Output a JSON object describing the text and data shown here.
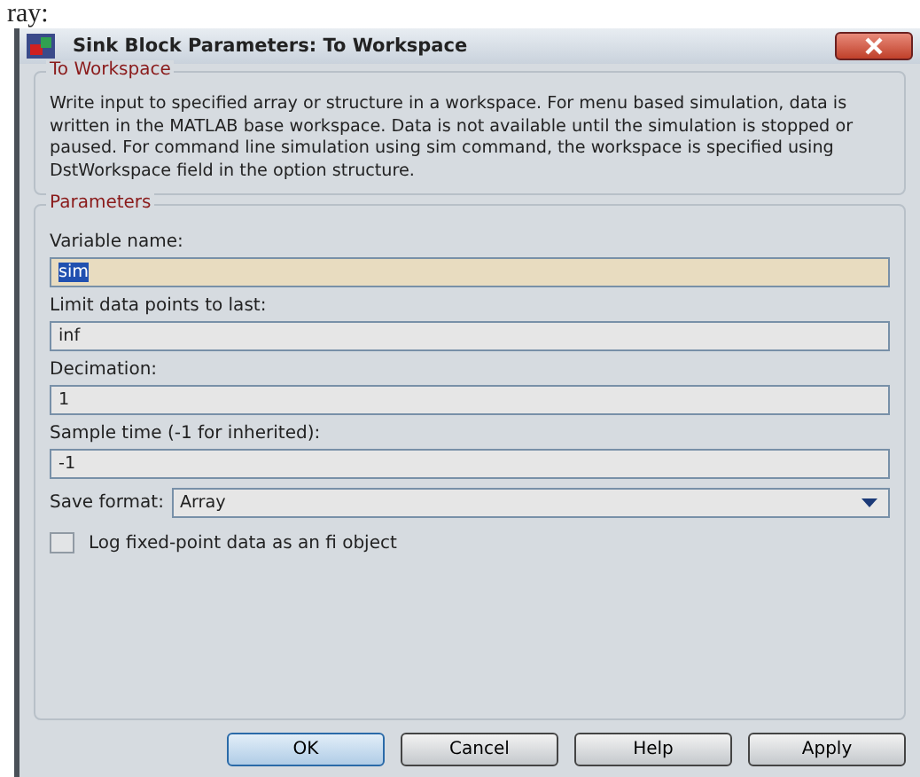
{
  "page_text": "ray:",
  "window": {
    "title": "Sink Block Parameters: To Workspace"
  },
  "description_group": {
    "title": "To Workspace",
    "text": "Write input to specified array or structure in a workspace. For menu based simulation, data is written in the MATLAB base workspace. Data is not available until the simulation is stopped or paused. For command line simulation using sim command, the workspace is specified using DstWorkspace field in the option structure."
  },
  "parameters_group": {
    "title": "Parameters",
    "fields": [
      {
        "label": "Variable name:",
        "value": "sim",
        "focused": true
      },
      {
        "label": "Limit data points to last:",
        "value": "inf",
        "focused": false
      },
      {
        "label": "Decimation:",
        "value": "1",
        "focused": false
      },
      {
        "label": "Sample time (-1 for inherited):",
        "value": "-1",
        "focused": false
      }
    ],
    "save_format": {
      "label": "Save format:",
      "value": "Array"
    },
    "checkbox": {
      "label": "Log fixed-point data as an fi object",
      "checked": false
    }
  },
  "buttons": [
    {
      "label": "OK",
      "default": true
    },
    {
      "label": "Cancel",
      "default": false
    },
    {
      "label": "Help",
      "default": false
    },
    {
      "label": "Apply",
      "default": false
    }
  ]
}
